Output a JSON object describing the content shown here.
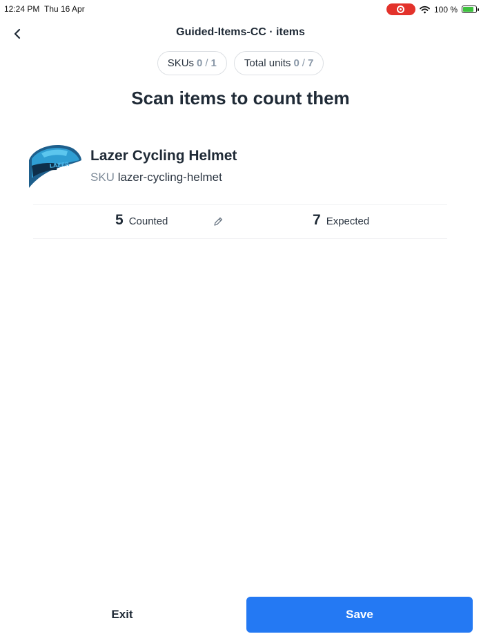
{
  "status_bar": {
    "time": "12:24 PM",
    "date": "Thu 16 Apr",
    "battery": "100 %",
    "icons": [
      "screen-record-icon",
      "wifi-icon",
      "battery-charging-icon"
    ]
  },
  "header": {
    "title": "Guided-Items-CC · items",
    "back_icon": "chevron-left-icon"
  },
  "counters": {
    "skus": {
      "label": "SKUs",
      "count": "0",
      "separator": "/",
      "total": "1"
    },
    "units": {
      "label": "Total units",
      "count": "0",
      "separator": "/",
      "total": "7"
    }
  },
  "heading": "Scan items to count them",
  "product": {
    "name": "Lazer Cycling Helmet",
    "sku_label": "SKU",
    "sku": "lazer-cycling-helmet",
    "counted_value": "5",
    "counted_label": "Counted",
    "expected_value": "7",
    "expected_label": "Expected",
    "edit_icon": "pencil-icon"
  },
  "footer": {
    "exit_label": "Exit",
    "save_label": "Save"
  },
  "colors": {
    "primary": "#2479f3",
    "text": "#1f2a36",
    "muted": "#8a98a8",
    "record": "#e3322b",
    "battery": "#3ec13e"
  }
}
